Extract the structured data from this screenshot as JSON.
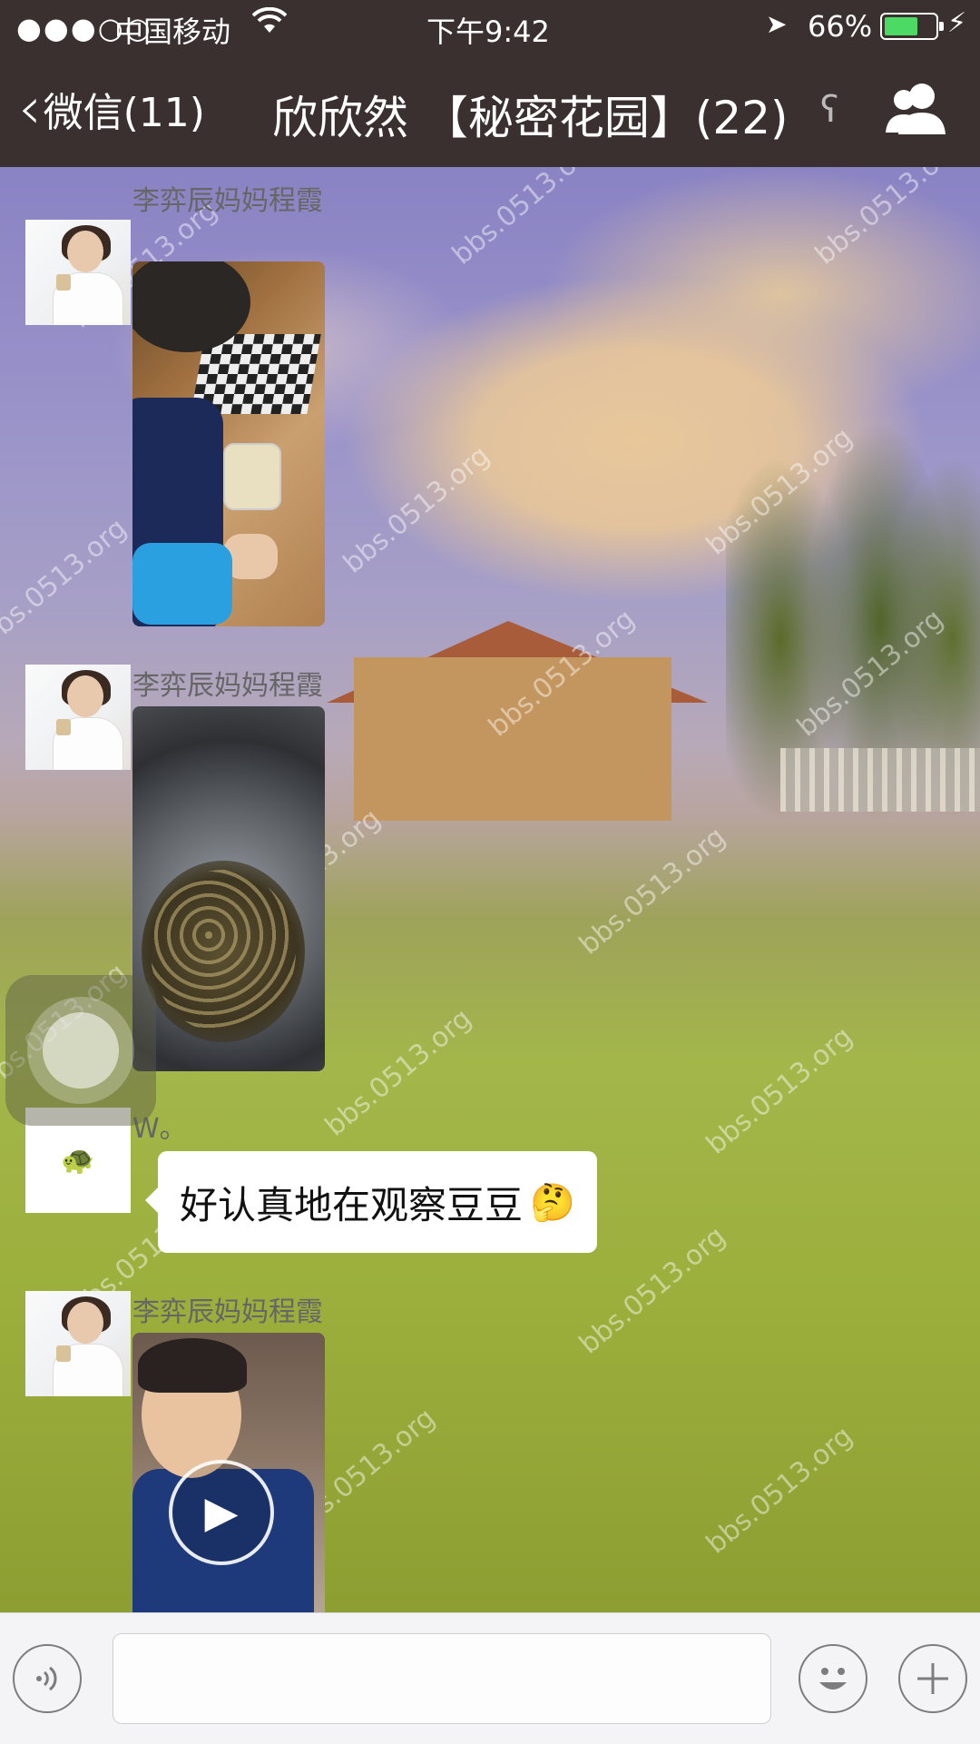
{
  "status_bar": {
    "signal": "●●●○○",
    "carrier": "中国移动",
    "time": "下午9:42",
    "battery_percent": "66%",
    "battery_level": 0.66
  },
  "nav": {
    "back_label": "微信(11)",
    "title": "欣欣然 【秘密花园】(22)"
  },
  "watermark": "bbs.0513.org",
  "messages": [
    {
      "type": "image",
      "sender": "李弈辰妈妈程霞",
      "image": "boy playing chess with jar of beans"
    },
    {
      "type": "image",
      "sender": "李弈辰妈妈程霞",
      "image": "beans in a glass jar"
    },
    {
      "type": "text",
      "sender": "W。",
      "text": "好认真地在观察豆豆",
      "emoji": "🤔"
    },
    {
      "type": "video",
      "sender": "李弈辰妈妈程霞",
      "image": "child video thumbnail"
    }
  ],
  "input_bar": {
    "voice_icon": "voice-icon",
    "emoji_icon": "emoji-icon",
    "plus_icon": "plus-icon"
  },
  "colors": {
    "bar_bg": "#3a3030",
    "battery_green": "#4cd964",
    "bubble_bg": "#ffffff"
  }
}
